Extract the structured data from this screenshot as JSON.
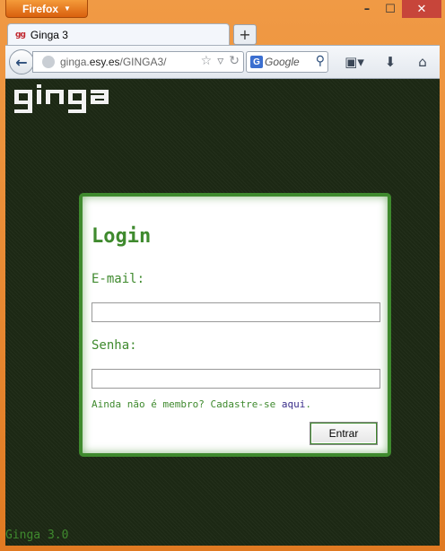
{
  "browser": {
    "menu_button": "Firefox",
    "tab_title": "Ginga 3",
    "tab_favicon": "ginga-favicon",
    "new_tab": "+",
    "url_prefix": "ginga.",
    "url_host": "esy.es",
    "url_path": "/GINGA3/",
    "search_placeholder": "Google",
    "search_engine": "G"
  },
  "window": {
    "minimize": "–",
    "maximize": "☐",
    "close": "✕"
  },
  "page": {
    "logo": "ginga",
    "login": {
      "title": "Login",
      "email_label": "E-mail:",
      "email_value": "",
      "password_label": "Senha:",
      "password_value": "",
      "signup_text": "Ainda não é membro? Cadastre-se ",
      "signup_link": "aqui",
      "signup_end": ".",
      "submit": "Entrar"
    },
    "footer": "Ginga 3.0"
  },
  "colors": {
    "accent_green": "#3f8a2e",
    "page_background": "#1c2814",
    "window_frame": "#e68a33"
  }
}
